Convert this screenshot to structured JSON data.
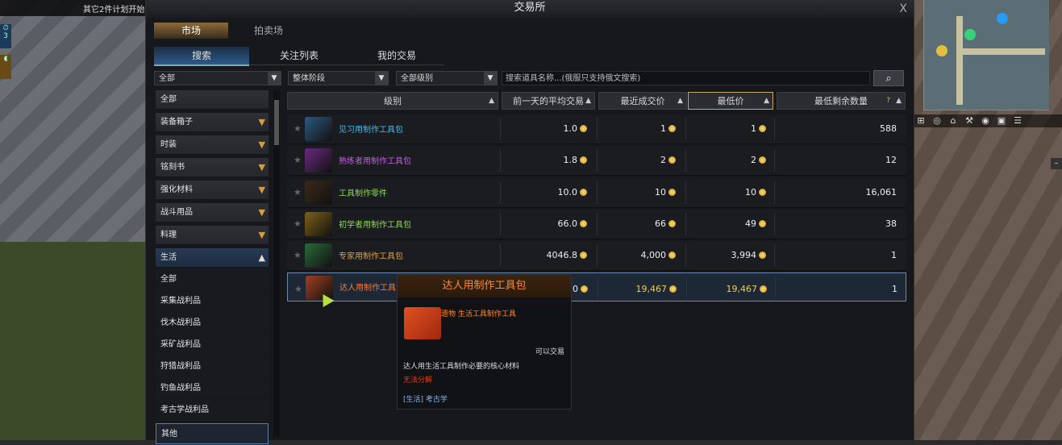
{
  "topbar_left": {
    "text": "其它2件计划开始",
    "close": "X"
  },
  "left_hud": {
    "badge": "3"
  },
  "window": {
    "title": "交易所",
    "close": "X"
  },
  "tabs_primary": [
    {
      "label": "市场",
      "active": true
    },
    {
      "label": "拍卖场",
      "active": false
    }
  ],
  "tabs_secondary": [
    {
      "label": "搜索",
      "active": true
    },
    {
      "label": "关注列表",
      "active": false
    },
    {
      "label": "我的交易",
      "active": false
    }
  ],
  "filters": {
    "category": "全部",
    "tier": "整体阶段",
    "grade": "全部级别",
    "search_placeholder": "搜索道具名称...(俄服只支持俄文搜索)"
  },
  "categories": [
    {
      "label": "全部"
    },
    {
      "label": "装备箱子"
    },
    {
      "label": "时装"
    },
    {
      "label": "铭刻书"
    },
    {
      "label": "强化材料"
    },
    {
      "label": "战斗用品"
    },
    {
      "label": "料理"
    },
    {
      "label": "生活"
    }
  ],
  "sub_categories": [
    "全部",
    "采集战利品",
    "伐木战利品",
    "采矿战利品",
    "狩猎战利品",
    "钓鱼战利品",
    "考古学战利品",
    "其他"
  ],
  "table": {
    "headers": [
      "级别",
      "前一天的平均交易",
      "最近成交价",
      "最低价",
      "最低剩余数量"
    ],
    "help_icon": "?",
    "rows": [
      {
        "name": "见习用制作工具包",
        "name_color": "#4ab8e8",
        "avg": "1.0",
        "recent": "1",
        "lowest": "1",
        "qty": "588",
        "icon_color": "#2a5a80"
      },
      {
        "name": "熟练者用制作工具包",
        "name_color": "#c060e0",
        "avg": "1.8",
        "recent": "2",
        "lowest": "2",
        "qty": "12",
        "icon_color": "#6a2a80"
      },
      {
        "name": "工具制作零件",
        "name_color": "#8ed85a",
        "avg": "10.0",
        "recent": "10",
        "lowest": "10",
        "qty": "16,061",
        "icon_color": "#3a2a1a"
      },
      {
        "name": "初学者用制作工具包",
        "name_color": "#8ed85a",
        "avg": "66.0",
        "recent": "66",
        "lowest": "49",
        "qty": "38",
        "icon_color": "#806018"
      },
      {
        "name": "专家用制作工具包",
        "name_color": "#e0a040",
        "avg": "4046.8",
        "recent": "4,000",
        "lowest": "3,994",
        "qty": "1",
        "icon_color": "#2a6a3a"
      },
      {
        "name": "达人用制作工具包",
        "name_color": "#ff7a30",
        "avg": "0",
        "recent": "19,467",
        "lowest": "19,467",
        "qty": "1",
        "icon_color": "#a04020"
      }
    ]
  },
  "tooltip": {
    "title": "达人用制作工具包",
    "category": "遗物 生活工具制作工具",
    "tradable": "可以交易",
    "description": "达人用生活工具制作必要的核心材料",
    "no_decompose": "无法分解",
    "tag": "[生活] 考古学"
  },
  "minimap_icons": [
    "⊞",
    "◎",
    "⌂",
    "⚒",
    "◉",
    "▣",
    "☰"
  ],
  "accent": "#c9a86a"
}
